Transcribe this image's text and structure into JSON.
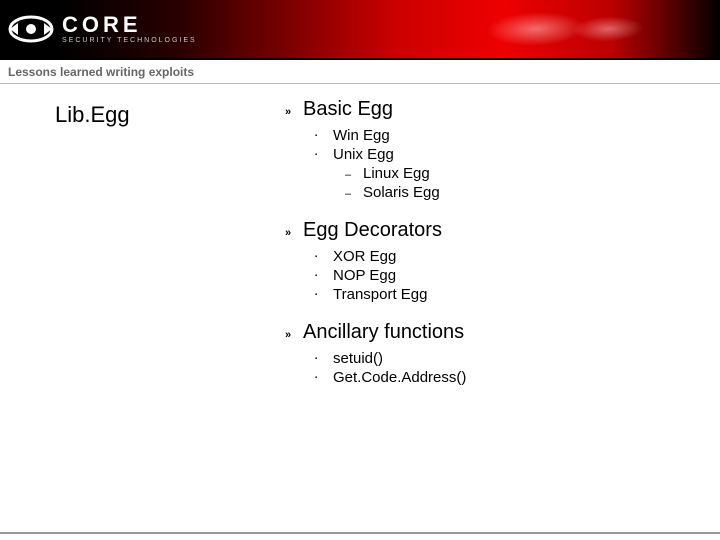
{
  "brand": {
    "name": "CORE",
    "tagline": "SECURITY TECHNOLOGIES"
  },
  "subtitle": "Lessons learned writing exploits",
  "slide_title": "Lib.Egg",
  "sections": [
    {
      "title": "Basic Egg",
      "items": [
        {
          "text": "Win Egg",
          "children": []
        },
        {
          "text": "Unix Egg",
          "children": [
            "Linux Egg",
            "Solaris Egg"
          ]
        }
      ]
    },
    {
      "title": "Egg Decorators",
      "items": [
        {
          "text": "XOR Egg",
          "children": []
        },
        {
          "text": "NOP Egg",
          "children": []
        },
        {
          "text": "Transport Egg",
          "children": []
        }
      ]
    },
    {
      "title": "Ancillary functions",
      "items": [
        {
          "text": "setuid()",
          "children": []
        },
        {
          "text": "Get.Code.Address()",
          "children": []
        }
      ]
    }
  ]
}
